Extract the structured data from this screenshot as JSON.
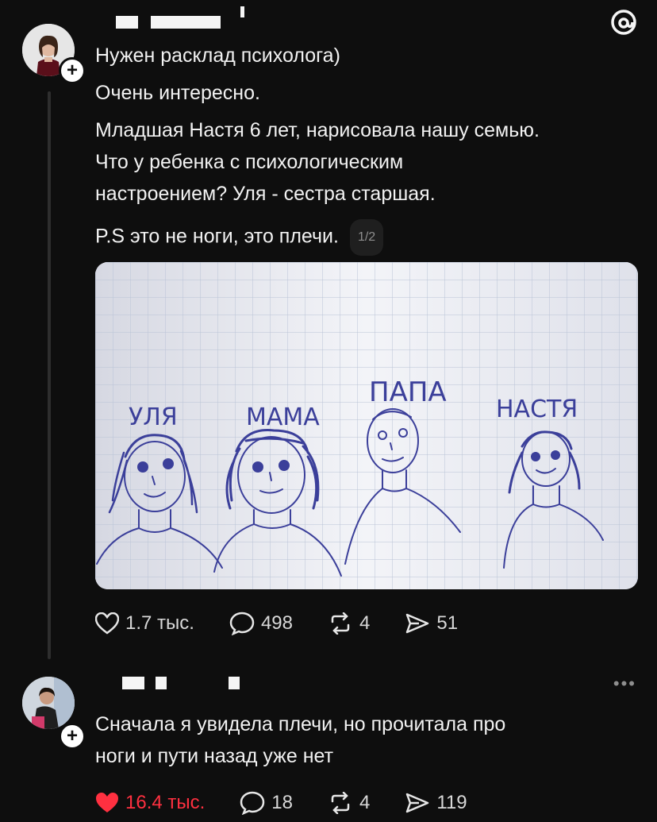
{
  "app": {
    "logo_icon": "threads-icon"
  },
  "post1": {
    "lines": [
      "Нужен расклад психолога)",
      "Очень интересно."
    ],
    "paragraph": [
      "Младшая Настя 6 лет, нарисовала нашу семью.",
      "Что у ребенка с психологическим",
      "настроением? Уля - сестра старшая."
    ],
    "ps": "P.S это не ноги, это плечи.",
    "page_indicator": "1/2",
    "drawing_labels": {
      "ulya": "УЛЯ",
      "mama": "МАМА",
      "papa": "ПАПА",
      "nastya": "НАСТЯ"
    },
    "actions": {
      "likes": "1.7 тыс.",
      "replies": "498",
      "reposts": "4",
      "shares": "51"
    }
  },
  "post2": {
    "text": [
      "Сначала я увидела плечи, но прочитала про",
      "ноги и пути назад уже нет"
    ],
    "more_label": "•••",
    "actions": {
      "likes": "16.4 тыс.",
      "replies": "18",
      "reposts": "4",
      "shares": "119"
    }
  },
  "colors": {
    "background": "#0e0e0e",
    "text": "#f2f2f2",
    "muted": "#8e8e8e",
    "like_active": "#ff3040",
    "pen_ink": "#3b3f9a"
  }
}
